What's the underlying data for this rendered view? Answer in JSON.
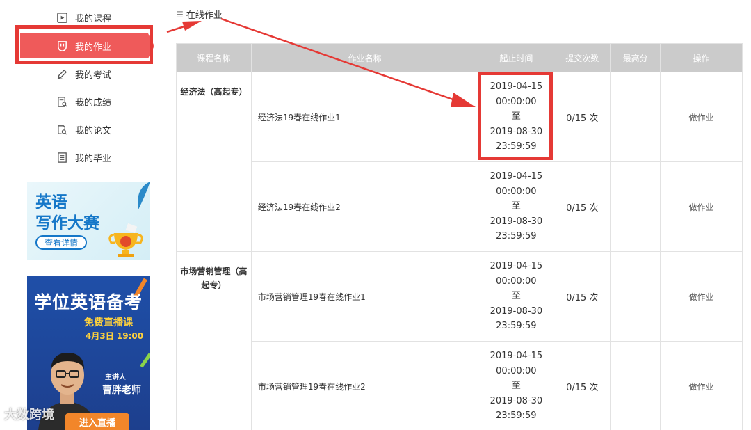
{
  "sidebar": {
    "items": [
      {
        "label": "我的课程",
        "icon": "play-icon"
      },
      {
        "label": "我的作业",
        "icon": "shield-icon",
        "active": true
      },
      {
        "label": "我的考试",
        "icon": "pencil-icon"
      },
      {
        "label": "我的成绩",
        "icon": "report-search-icon"
      },
      {
        "label": "我的论文",
        "icon": "paper-search-icon"
      },
      {
        "label": "我的毕业",
        "icon": "graduation-doc-icon"
      }
    ]
  },
  "banner1": {
    "line1": "英语",
    "line2": "写作大赛",
    "button": "查看详情"
  },
  "banner2": {
    "title": "学位英语备考",
    "subtitle": "免费直播课",
    "time": "4月3日 19:00",
    "speaker_label": "主讲人",
    "teacher": "曹胖老师",
    "button": "进入直播"
  },
  "watermark": "大数跨境",
  "page": {
    "title": "在线作业"
  },
  "table": {
    "headers": [
      "课程名称",
      "作业名称",
      "起止时间",
      "提交次数",
      "最高分",
      "操作"
    ],
    "groups": [
      {
        "course": "经济法（高起专）",
        "rows": [
          {
            "name": "经济法19春在线作业1",
            "start_date": "2019-04-15",
            "start_time": "00:00:00",
            "to": "至",
            "end_date": "2019-08-30",
            "end_time": "23:59:59",
            "submits": "0/15 次",
            "score": "",
            "action": "做作业"
          },
          {
            "name": "经济法19春在线作业2",
            "start_date": "2019-04-15",
            "start_time": "00:00:00",
            "to": "至",
            "end_date": "2019-08-30",
            "end_time": "23:59:59",
            "submits": "0/15 次",
            "score": "",
            "action": "做作业"
          }
        ]
      },
      {
        "course": "市场营销管理（高起专）",
        "rows": [
          {
            "name": "市场营销管理19春在线作业1",
            "start_date": "2019-04-15",
            "start_time": "00:00:00",
            "to": "至",
            "end_date": "2019-08-30",
            "end_time": "23:59:59",
            "submits": "0/15 次",
            "score": "",
            "action": "做作业"
          },
          {
            "name": "市场营销管理19春在线作业2",
            "start_date": "2019-04-15",
            "start_time": "00:00:00",
            "to": "至",
            "end_date": "2019-08-30",
            "end_time": "23:59:59",
            "submits": "0/15 次",
            "score": "",
            "action": "做作业"
          }
        ]
      }
    ]
  },
  "colors": {
    "accent": "#ef5a5a",
    "annotation": "#e53935",
    "header_bg": "#cbcbcb"
  }
}
